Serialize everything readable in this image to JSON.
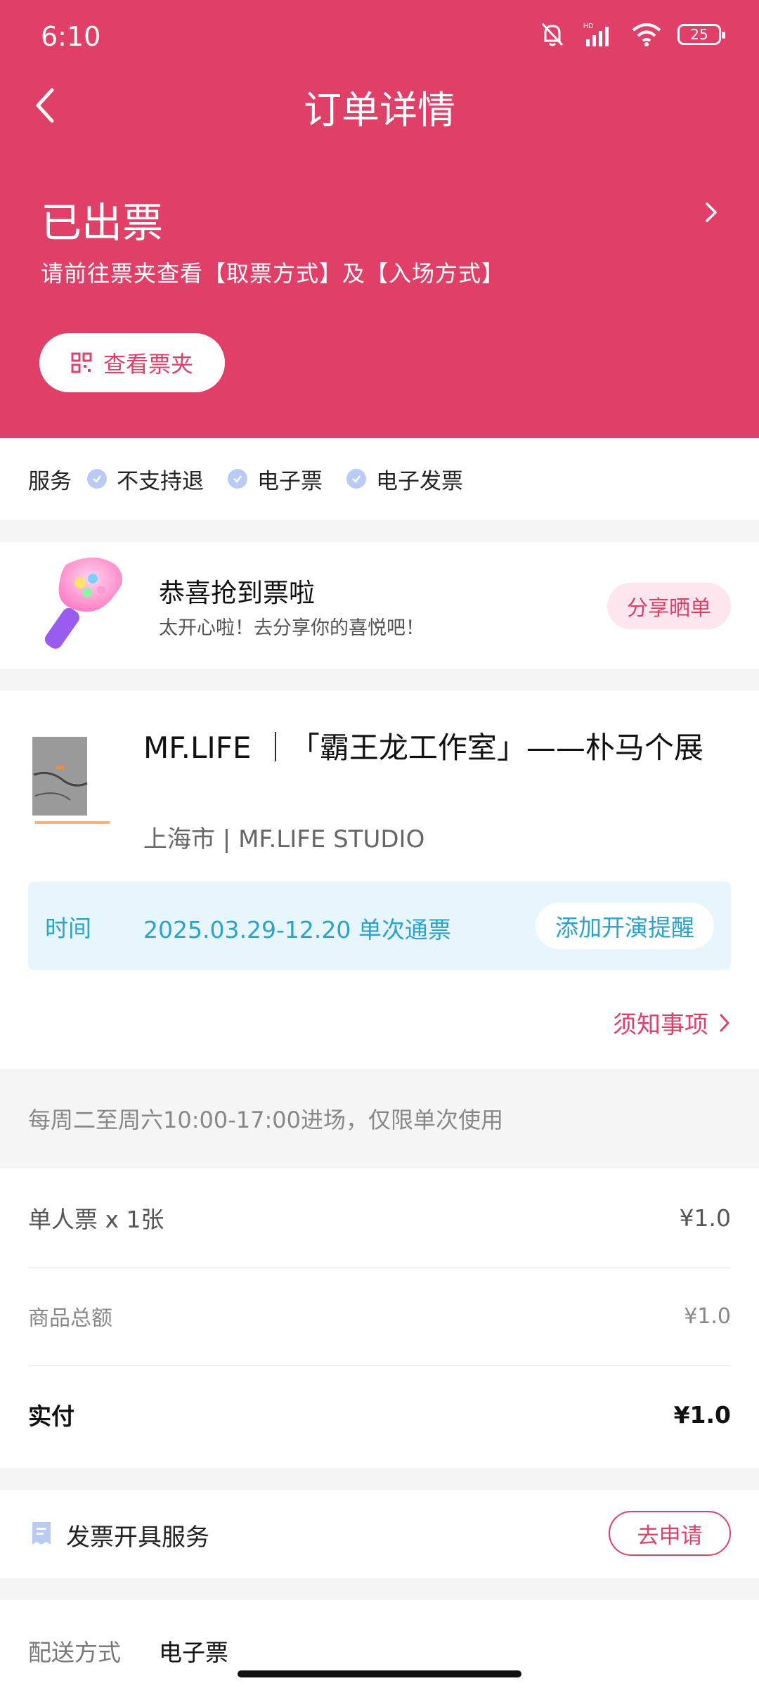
{
  "status_bar": {
    "time": "6:10",
    "battery": "25"
  },
  "header": {
    "title": "订单详情",
    "status_title": "已出票",
    "status_desc": "请前往票夹查看【取票方式】及【入场方式】",
    "view_ticket_label": "查看票夹"
  },
  "services": {
    "label": "服务",
    "items": [
      "不支持退",
      "电子票",
      "电子发票"
    ]
  },
  "share": {
    "title": "恭喜抢到票啦",
    "subtitle": "太开心啦！去分享你的喜悦吧！",
    "button": "分享晒单"
  },
  "event": {
    "title": "MF.LIFE ｜「霸王龙工作室」——朴马个展",
    "venue": "上海市 | MF.LIFE STUDIO",
    "time_label": "时间",
    "time_value": "2025.03.29-12.20 单次通票",
    "remind_button": "添加开演提醒",
    "notice_link": "须知事项"
  },
  "usage_note": "每周二至周六10:00-17:00进场，仅限单次使用",
  "prices": {
    "ticket_label": "单人票 x 1张",
    "ticket_price": "¥1.0",
    "subtotal_label": "商品总额",
    "subtotal": "¥1.0",
    "paid_label": "实付",
    "paid": "¥1.0"
  },
  "invoice": {
    "label": "发票开具服务",
    "button": "去申请"
  },
  "delivery": {
    "label": "配送方式",
    "value": "电子票"
  },
  "colors": {
    "brand": "#e04068",
    "info_blue": "#2aa2cc",
    "info_bg": "#e7f6fd"
  }
}
